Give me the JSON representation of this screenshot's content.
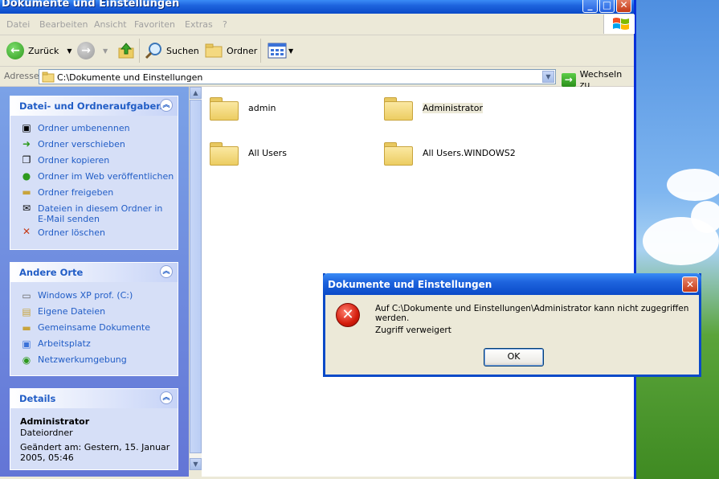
{
  "window": {
    "title": "Dokumente und Einstellungen",
    "min_label": "_",
    "max_label": "□",
    "close_label": "✕"
  },
  "menu": [
    "Datei",
    "Bearbeiten",
    "Ansicht",
    "Favoriten",
    "Extras",
    "?"
  ],
  "toolbar": {
    "back_label": "Zurück",
    "search_label": "Suchen",
    "folders_label": "Ordner"
  },
  "address": {
    "label": "Adresse",
    "value": "C:\\Dokumente und Einstellungen",
    "go_label": "Wechseln zu"
  },
  "tasks_panel": {
    "title": "Datei- und Ordneraufgaben",
    "items": [
      "Ordner umbenennen",
      "Ordner verschieben",
      "Ordner kopieren",
      "Ordner im Web veröffentlichen",
      "Ordner freigeben",
      "Dateien in diesem Ordner in",
      "E-Mail senden",
      "Ordner löschen"
    ]
  },
  "places_panel": {
    "title": "Andere Orte",
    "items": [
      "Windows XP prof. (C:)",
      "Eigene Dateien",
      "Gemeinsame Dokumente",
      "Arbeitsplatz",
      "Netzwerkumgebung"
    ]
  },
  "details_panel": {
    "title": "Details",
    "name": "Administrator",
    "type": "Dateiordner",
    "modified_line1": "Geändert am: Gestern, 15. Januar",
    "modified_line2": "2005, 05:46"
  },
  "folders": [
    "admin",
    "Administrator",
    "All Users",
    "All Users.WINDOWS2"
  ],
  "dialog": {
    "title": "Dokumente und Einstellungen",
    "message": "Auf C:\\Dokumente und Einstellungen\\Administrator kann nicht zugegriffen werden.",
    "detail": "Zugriff verweigert",
    "ok_label": "OK",
    "close_label": "✕"
  }
}
